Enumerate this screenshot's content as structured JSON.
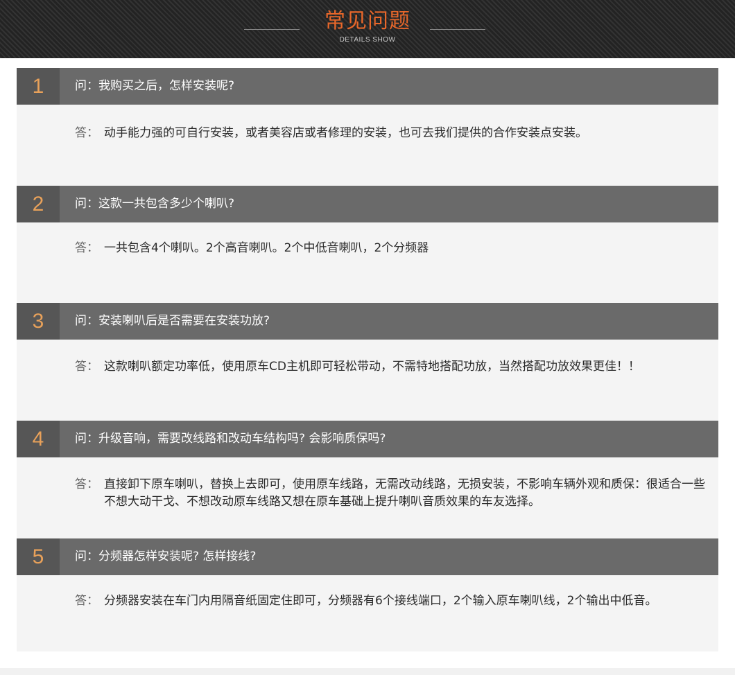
{
  "header": {
    "title": "常见问题",
    "subtitle": "DETAILS SHOW"
  },
  "faq": [
    {
      "number": "1",
      "question": "问：我购买之后，怎样安装呢?",
      "answer_prefix": "答：",
      "answer": "动手能力强的可自行安装，或者美容店或者修理的安装，也可去我们提供的合作安装点安装。"
    },
    {
      "number": "2",
      "question": "问：这款一共包含多少个喇叭?",
      "answer_prefix": "答：",
      "answer": "一共包含4个喇叭。2个高音喇叭。2个中低音喇叭，2个分频器"
    },
    {
      "number": "3",
      "question": "问：安装喇叭后是否需要在安装功放?",
      "answer_prefix": "答：",
      "answer": "这款喇叭额定功率低，使用原车CD主机即可轻松带动，不需特地搭配功放，当然搭配功放效果更佳！！"
    },
    {
      "number": "4",
      "question": "问：升级音响，需要改线路和改动车结构吗? 会影响质保吗?",
      "answer_prefix": "答：",
      "answer": "直接卸下原车喇叭，替换上去即可，使用原车线路，无需改动线路，无损安装，不影响车辆外观和质保：很适合一些不想大动干戈、不想改动原车线路又想在原车基础上提升喇叭音质效果的车友选择。"
    },
    {
      "number": "5",
      "question": "问：分频器怎样安装呢? 怎样接线?",
      "answer_prefix": "答：",
      "answer": "分频器安装在车门内用隔音纸固定住即可，分频器有6个接线端口，2个输入原车喇叭线，2个输出中低音。"
    }
  ]
}
